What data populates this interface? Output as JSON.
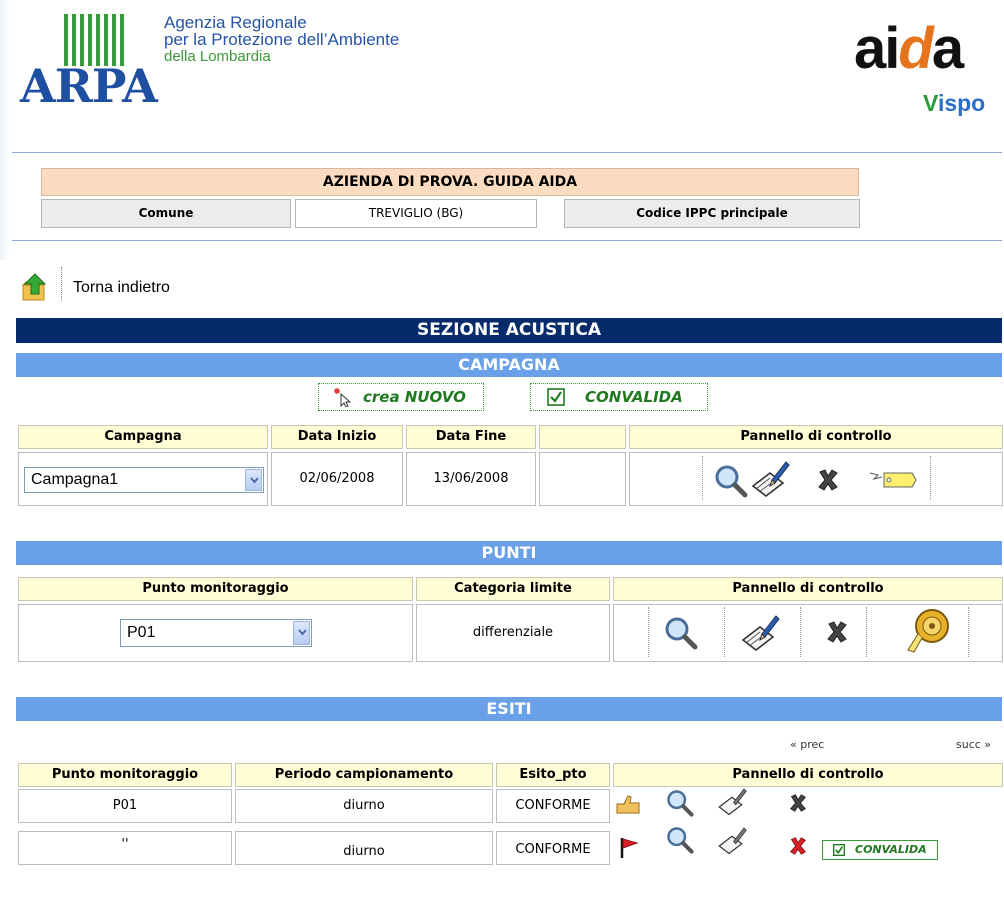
{
  "header": {
    "agency_line1": "Agenzia Regionale",
    "agency_line2": "per la Protezione dell’Ambiente",
    "agency_line3": "della Lombardia",
    "arpa_logo": "ARPA",
    "aida_logo_a": "ai",
    "aida_logo_d": "d",
    "aida_logo_b": "a",
    "vispo_v": "V",
    "vispo_rest": "ispo",
    "colors": {
      "arpa_blue": "#1f4fa0",
      "arpa_green": "#3a9a3a",
      "aida_orange": "#e5741c"
    }
  },
  "company": {
    "name": "AZIENDA DI PROVA. GUIDA AIDA",
    "comune_label": "Comune",
    "comune_value": "TREVIGLIO (BG)",
    "ippc_label": "Codice IPPC principale"
  },
  "back": {
    "label": "Torna indietro",
    "icon": "folder-up-arrow-icon"
  },
  "section_title": "SEZIONE ACUSTICA",
  "campagna": {
    "title": "CAMPAGNA",
    "new_button": "crea NUOVO",
    "validate_button": "CONVALIDA",
    "headers": [
      "Campagna",
      "Data Inizio",
      "Data Fine",
      "",
      "Pannello di controllo"
    ],
    "selected": "Campagna1",
    "data_inizio": "02/06/2008",
    "data_fine": "13/06/2008",
    "controls": [
      "magnifier-icon",
      "edit-pencil-icon",
      "delete-x-icon",
      "tag-icon"
    ]
  },
  "punti": {
    "title": "PUNTI",
    "headers": [
      "Punto monitoraggio",
      "Categoria limite",
      "Pannello di controllo"
    ],
    "selected": "P01",
    "categoria": "differenziale",
    "controls": [
      "magnifier-icon",
      "edit-pencil-icon",
      "delete-x-icon",
      "measuring-tape-icon"
    ]
  },
  "esiti": {
    "title": "ESITI",
    "prev": "« prec",
    "next": "succ »",
    "headers": [
      "Punto monitoraggio",
      "Periodo campionamento",
      "Esito_pto",
      "Pannello di controllo"
    ],
    "rows": [
      {
        "punto": "P01",
        "periodo": "diurno",
        "esito": "CONFORME"
      },
      {
        "punto": "''",
        "periodo": "diurno",
        "esito": "CONFORME",
        "validate": "CONVALIDA"
      }
    ]
  }
}
